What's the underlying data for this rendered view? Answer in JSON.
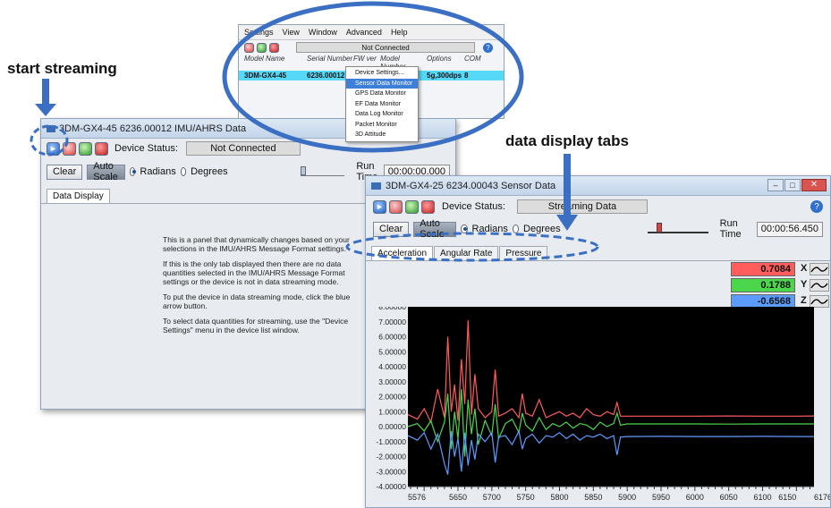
{
  "annotations": {
    "start_streaming": "start streaming",
    "data_display_tabs": "data display tabs"
  },
  "device_list_window": {
    "menus": [
      "Settings",
      "View",
      "Window",
      "Advanced",
      "Help"
    ],
    "status": "Not Connected",
    "columns": [
      "Model Name",
      "Serial Number",
      "FW ver",
      "Model Number",
      "Options",
      "COM"
    ],
    "row": {
      "model_name": "3DM-GX4-45",
      "serial_number": "6236.00012",
      "fw_ver": "",
      "model_number": "",
      "options": "5g,300dps",
      "com": "8"
    },
    "context_menu": [
      "Device Settings...",
      "Sensor Data Monitor",
      "GPS Data Monitor",
      "EF Data Monitor",
      "Data Log Monitor",
      "Packet Monitor",
      "3D Attitude"
    ],
    "context_menu_selected": "Sensor Data Monitor"
  },
  "imu_window": {
    "title": "3DM-GX4-45 6236.00012 IMU/AHRS Data",
    "device_status_label": "Device Status:",
    "device_status": "Not Connected",
    "clear_label": "Clear",
    "auto_scale_label": "Auto Scale",
    "radians_label": "Radians",
    "degrees_label": "Degrees",
    "run_time_label": "Run Time",
    "run_time": "00:00:00.000",
    "tab": "Data Display",
    "info_paragraphs": [
      "This is a panel that dynamically changes based on your selections in the IMU/AHRS Message Format settings.",
      "If this is the only tab displayed then there are no data quantities selected in the IMU/AHRS Message Format settings or the device is not in data streaming mode.",
      "To put the device in data streaming mode, click the blue arrow button.",
      "To select data quantities for streaming, use the \"Device Settings\" menu in the device list window."
    ]
  },
  "sensor_window": {
    "title": "3DM-GX4-25 6234.00043 Sensor Data",
    "device_status_label": "Device Status:",
    "device_status": "Streaming Data",
    "clear_label": "Clear",
    "auto_scale_label": "Auto Scale",
    "radians_label": "Radians",
    "degrees_label": "Degrees",
    "run_time_label": "Run Time",
    "run_time": "00:00:56.450",
    "tabs": [
      "Acceleration",
      "Angular Rate",
      "Pressure"
    ],
    "active_tab": "Acceleration",
    "legend": [
      {
        "value": "0.7084",
        "axis": "X",
        "color": "#ff5c5c"
      },
      {
        "value": "0.1788",
        "axis": "Y",
        "color": "#4cd64c"
      },
      {
        "value": "-0.6568",
        "axis": "Z",
        "color": "#5c9cff"
      }
    ]
  },
  "chart_data": {
    "type": "line",
    "title": "",
    "xlabel": "",
    "ylabel": "",
    "xlim": [
      5576,
      6176
    ],
    "ylim": [
      -4,
      8
    ],
    "x_ticks": [
      "5576",
      "5650",
      "5700",
      "5750",
      "5800",
      "5850",
      "5900",
      "5950",
      "6000",
      "6050",
      "6100",
      "6150",
      "6176"
    ],
    "y_ticks": [
      "8.00000",
      "7.00000",
      "6.00000",
      "5.00000",
      "4.00000",
      "3.00000",
      "2.00000",
      "1.00000",
      "0.00000",
      "-1.00000",
      "-2.00000",
      "-3.00000",
      "-4.00000"
    ],
    "background": "#000000",
    "series": [
      {
        "name": "X",
        "color": "#ff5c5c",
        "x": [
          5576,
          5590,
          5600,
          5610,
          5620,
          5630,
          5635,
          5640,
          5645,
          5650,
          5655,
          5660,
          5665,
          5670,
          5675,
          5680,
          5690,
          5700,
          5705,
          5710,
          5720,
          5730,
          5740,
          5745,
          5750,
          5760,
          5770,
          5780,
          5790,
          5800,
          5810,
          5820,
          5830,
          5840,
          5850,
          5860,
          5870,
          5880,
          5885,
          5890,
          5900,
          5950,
          6000,
          6050,
          6100,
          6150,
          6176
        ],
        "values": [
          0.8,
          0.5,
          1.2,
          0.3,
          2.5,
          0.6,
          6.0,
          1.0,
          2.8,
          0.4,
          4.5,
          1.5,
          7.1,
          0.8,
          3.5,
          1.2,
          0.6,
          1.0,
          3.8,
          0.7,
          0.9,
          1.2,
          0.6,
          2.2,
          0.9,
          0.7,
          1.8,
          0.6,
          0.8,
          1.0,
          0.7,
          0.9,
          0.6,
          1.2,
          0.8,
          0.7,
          1.0,
          0.8,
          1.6,
          0.7,
          0.7,
          0.7,
          0.7,
          0.71,
          0.7,
          0.7,
          0.71
        ]
      },
      {
        "name": "Y",
        "color": "#4cd64c",
        "x": [
          5576,
          5590,
          5600,
          5610,
          5620,
          5630,
          5635,
          5640,
          5645,
          5650,
          5655,
          5660,
          5665,
          5670,
          5675,
          5680,
          5690,
          5700,
          5705,
          5710,
          5720,
          5730,
          5740,
          5745,
          5750,
          5760,
          5770,
          5780,
          5790,
          5800,
          5810,
          5820,
          5830,
          5840,
          5850,
          5860,
          5870,
          5880,
          5885,
          5890,
          5900,
          5950,
          6000,
          6050,
          6100,
          6150,
          6176
        ],
        "values": [
          0.0,
          0.2,
          -0.3,
          0.4,
          -1.0,
          0.3,
          2.2,
          -1.5,
          1.0,
          -0.8,
          2.5,
          -2.0,
          1.8,
          -0.5,
          1.2,
          -1.2,
          0.4,
          -0.6,
          1.5,
          -0.8,
          0.2,
          0.5,
          -0.4,
          0.9,
          0.1,
          -0.3,
          0.6,
          -0.2,
          0.2,
          0.0,
          0.3,
          -0.1,
          0.2,
          0.1,
          -0.2,
          0.3,
          0.0,
          0.2,
          0.9,
          0.1,
          0.18,
          0.18,
          0.18,
          0.17,
          0.18,
          0.18,
          0.18
        ]
      },
      {
        "name": "Z",
        "color": "#5c9cff",
        "x": [
          5576,
          5590,
          5600,
          5610,
          5620,
          5630,
          5635,
          5640,
          5645,
          5650,
          5655,
          5660,
          5665,
          5670,
          5675,
          5680,
          5690,
          5700,
          5705,
          5710,
          5720,
          5730,
          5740,
          5745,
          5750,
          5760,
          5770,
          5780,
          5790,
          5800,
          5810,
          5820,
          5830,
          5840,
          5850,
          5860,
          5870,
          5880,
          5885,
          5890,
          5900,
          5950,
          6000,
          6050,
          6100,
          6150,
          6176
        ],
        "values": [
          -0.6,
          -0.9,
          -0.4,
          -1.5,
          -0.5,
          -2.5,
          -3.2,
          -0.3,
          -2.0,
          -0.8,
          -3.0,
          -0.4,
          -2.6,
          -0.9,
          -2.2,
          -0.5,
          -1.0,
          -0.4,
          -2.4,
          -0.7,
          -0.6,
          -1.2,
          -0.3,
          -1.5,
          -0.8,
          -0.5,
          -1.1,
          -0.6,
          -0.7,
          -0.4,
          -0.8,
          -0.5,
          -0.9,
          -0.6,
          -0.7,
          -0.5,
          -0.8,
          -0.6,
          -1.9,
          -0.7,
          -0.66,
          -0.65,
          -0.66,
          -0.66,
          -0.65,
          -0.66,
          -0.66
        ]
      }
    ]
  }
}
